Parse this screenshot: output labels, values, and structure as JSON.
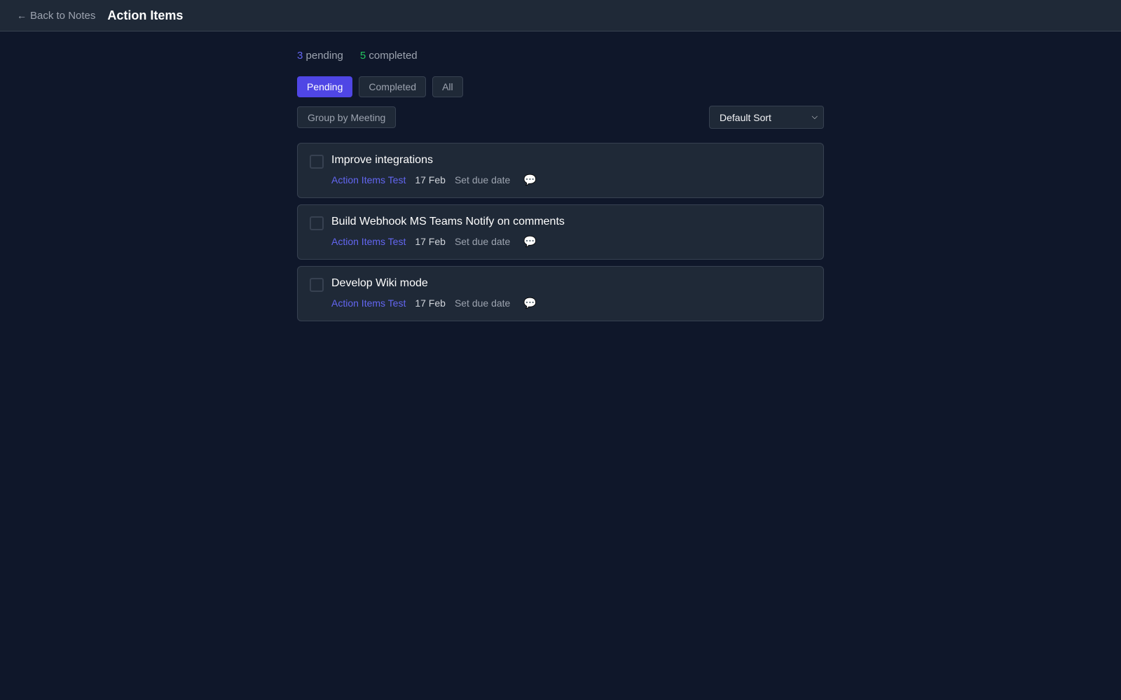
{
  "header": {
    "back_label": "Back to Notes",
    "back_icon": "arrow-left-icon",
    "title": "Action Items"
  },
  "stats": {
    "pending_count": "3",
    "pending_label": "pending",
    "completed_count": "5",
    "completed_label": "completed"
  },
  "tabs": [
    {
      "label": "Pending",
      "active": true
    },
    {
      "label": "Completed",
      "active": false
    },
    {
      "label": "All",
      "active": false
    }
  ],
  "controls": {
    "group_label": "Group by Meeting",
    "sort_value": "Default Sort"
  },
  "items": [
    {
      "title": "Improve integrations",
      "meeting": "Action Items Test",
      "date": "17 Feb",
      "due_label": "Set due date",
      "comment_icon": "speech-bubble-icon"
    },
    {
      "title": "Build Webhook MS Teams Notify on comments",
      "meeting": "Action Items Test",
      "date": "17 Feb",
      "due_label": "Set due date",
      "comment_icon": "speech-bubble-icon"
    },
    {
      "title": "Develop Wiki mode",
      "meeting": "Action Items Test",
      "date": "17 Feb",
      "due_label": "Set due date",
      "comment_icon": "speech-bubble-icon"
    }
  ],
  "colors": {
    "background": "#0f172a",
    "surface": "#1f2937",
    "accent": "#4f46e5",
    "pending_accent": "#6366f1",
    "completed_accent": "#22c55e"
  }
}
